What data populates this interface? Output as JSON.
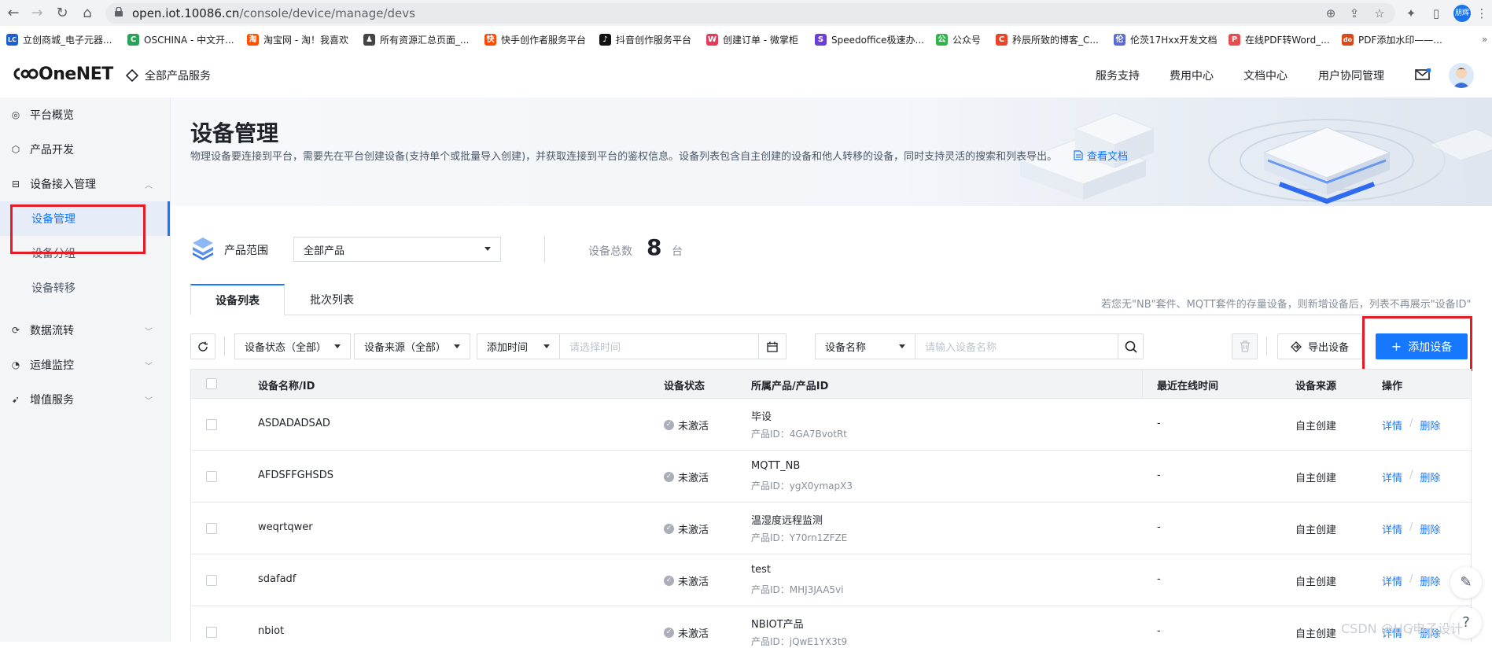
{
  "browser": {
    "url_domain": "open.iot.10086.cn",
    "url_path": "/console/device/manage/devs",
    "bookmarks": [
      {
        "label": "立创商城_电子元器...",
        "icon": "LC",
        "color": "#1d5fd0"
      },
      {
        "label": "OSCHINA - 中文开...",
        "icon": "C",
        "color": "#2aa35a"
      },
      {
        "label": "淘宝网 - 淘！我喜欢",
        "icon": "淘",
        "color": "#ff5000"
      },
      {
        "label": "所有资源汇总页面_...",
        "icon": "♟",
        "color": "#444444"
      },
      {
        "label": "快手创作者服务平台",
        "icon": "快",
        "color": "#ff4906"
      },
      {
        "label": "抖音创作服务平台",
        "icon": "♪",
        "color": "#111111"
      },
      {
        "label": "创建订单 - 微掌柜",
        "icon": "W",
        "color": "#e23c5a"
      },
      {
        "label": "Speedoffice极速办...",
        "icon": "S",
        "color": "#6a3fd6"
      },
      {
        "label": "公众号",
        "icon": "公",
        "color": "#2fb34a"
      },
      {
        "label": "矜辰所致的博客_C...",
        "icon": "C",
        "color": "#e8462b"
      },
      {
        "label": "伦茨17Hxx开发文档",
        "icon": "伦",
        "color": "#5b6bd6"
      },
      {
        "label": "在线PDF转Word_...",
        "icon": "P",
        "color": "#e94c4c"
      },
      {
        "label": "PDF添加水印——...",
        "icon": "do",
        "color": "#d94a1a"
      }
    ],
    "profile_label": "朋辉"
  },
  "header": {
    "logo": "OneNET",
    "all_products": "全部产品服务",
    "nav": [
      "服务支持",
      "费用中心",
      "文档中心",
      "用户协同管理"
    ]
  },
  "sidebar": {
    "items": [
      {
        "label": "平台概览",
        "icon": "overview-icon"
      },
      {
        "label": "产品开发",
        "icon": "product-icon"
      },
      {
        "label": "设备接入管理",
        "icon": "device-access-icon",
        "expanded": true
      },
      {
        "label": "数据流转",
        "icon": "dataflow-icon"
      },
      {
        "label": "运维监控",
        "icon": "monitor-icon"
      },
      {
        "label": "增值服务",
        "icon": "value-added-icon"
      }
    ],
    "subitems": [
      {
        "label": "设备管理",
        "active": true
      },
      {
        "label": "设备分组",
        "active": false
      },
      {
        "label": "设备转移",
        "active": false
      }
    ]
  },
  "page": {
    "title": "设备管理",
    "description": "物理设备要连接到平台，需要先在平台创建设备(支持单个或批量导入创建)，并获取连接到平台的鉴权信息。设备列表包含自主创建的设备和他人转移的设备，同时支持灵活的搜索和列表导出。",
    "doc_link": "查看文档"
  },
  "filters": {
    "product_scope_label": "产品范围",
    "product_scope_value": "全部产品",
    "device_total_label": "设备总数",
    "device_total_value": "8",
    "device_total_unit": "台"
  },
  "tabs": [
    {
      "label": "设备列表",
      "active": true
    },
    {
      "label": "批次列表",
      "active": false
    }
  ],
  "hint": "若您无\"NB\"套件、MQTT套件的存量设备，则新增设备后，列表不再展示\"设备ID\"",
  "toolbar": {
    "status_select": "设备状态（全部）",
    "source_select": "设备来源（全部）",
    "time_select": "添加时间",
    "time_placeholder": "请选择时间",
    "name_select": "设备名称",
    "name_placeholder": "请输入设备名称",
    "export_label": "导出设备",
    "add_label": "添加设备"
  },
  "table": {
    "columns": [
      "设备名称/ID",
      "设备状态",
      "所属产品/产品ID",
      "最近在线时间",
      "设备来源",
      "操作"
    ],
    "product_id_prefix": "产品ID：",
    "action_detail": "详情",
    "action_delete": "删除",
    "rows": [
      {
        "name": "ASDADADSAD",
        "status": "未激活",
        "product": "毕设",
        "product_id": "产品ID：4GA7BvotRt",
        "last_online": "-",
        "source": "自主创建"
      },
      {
        "name": "AFDSFFGHSDS",
        "status": "未激活",
        "product": "MQTT_NB",
        "product_id": "产品ID：ygX0ymapX3",
        "last_online": "-",
        "source": "自主创建"
      },
      {
        "name": "weqrtqwer",
        "status": "未激活",
        "product": "温湿度远程监测",
        "product_id": "产品ID：Y70rn1ZFZE",
        "last_online": "-",
        "source": "自主创建"
      },
      {
        "name": "sdafadf",
        "status": "未激活",
        "product": "test",
        "product_id": "产品ID：MHJ3JAA5vi",
        "last_online": "-",
        "source": "自主创建"
      },
      {
        "name": "nbiot",
        "status": "未激活",
        "product": "NBIOT产品",
        "product_id": "产品ID：jQwE1YX3t9",
        "last_online": "-",
        "source": "自主创建"
      }
    ]
  },
  "watermark": "CSDN @HG电子设计"
}
